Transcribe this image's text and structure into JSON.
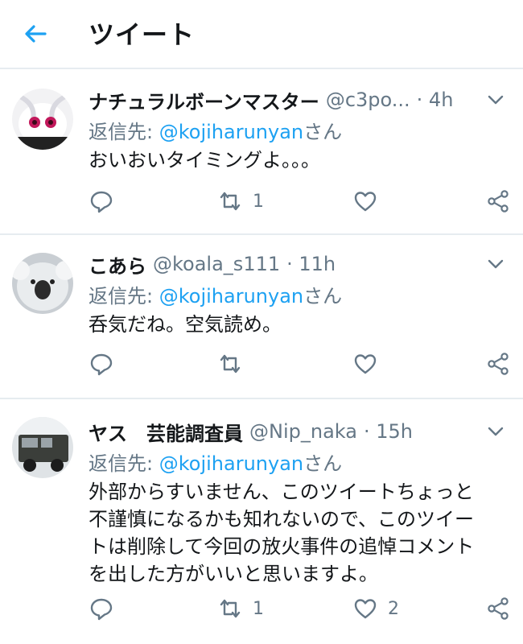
{
  "header": {
    "title": "ツイート"
  },
  "reply_to_prefix": "返信先: ",
  "reply_to_suffix": "さん",
  "tweets": [
    {
      "name": "ナチュラルボーンマスター",
      "handle": "@c3po...",
      "time": "· 4h",
      "reply_to": "@kojiharunyan",
      "text": "おいおいタイミングよ。。。",
      "retweets": "1",
      "likes": ""
    },
    {
      "name": "こあら",
      "handle": "@koala_s111",
      "time": "· 11h",
      "reply_to": "@kojiharunyan",
      "text": "呑気だね。空気読め。",
      "retweets": "",
      "likes": ""
    },
    {
      "name": "ヤス　芸能調査員",
      "handle": "@Nip_naka",
      "time": "· 15h",
      "reply_to": "@kojiharunyan",
      "text_lines": [
        "外部からすいません、このツイートちょっと",
        "不謹慎になるかも知れないので、このツイー",
        "トは削除して今回の放火事件の追悼コメント",
        "を出した方がいいと思いますよ。"
      ],
      "retweets": "1",
      "likes": "2"
    }
  ],
  "colors": {
    "accent": "#1da1f2",
    "muted": "#657786",
    "divider": "#e6ecf0"
  }
}
